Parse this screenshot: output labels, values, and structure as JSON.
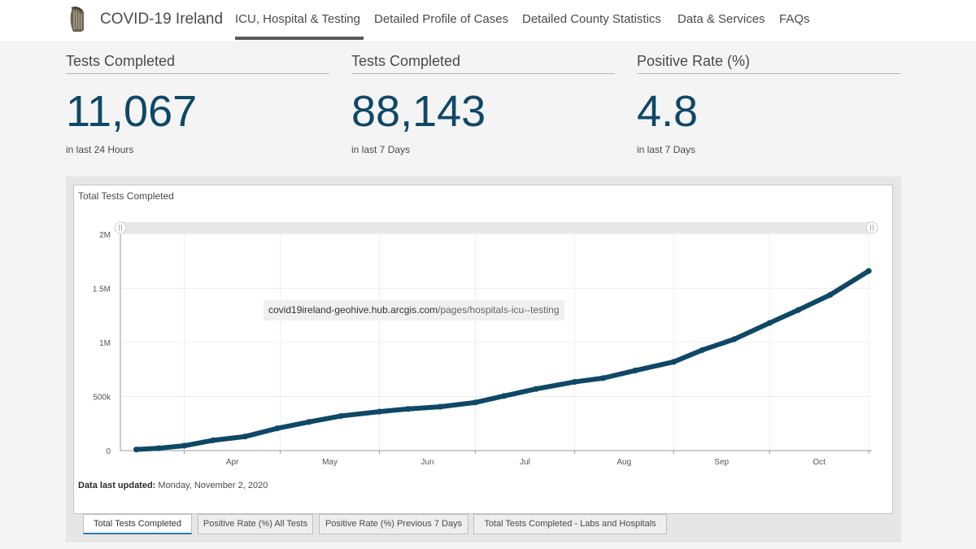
{
  "header": {
    "title": "COVID-19 Ireland",
    "nav": [
      {
        "label": "ICU, Hospital & Testing"
      },
      {
        "label": "Detailed Profile of Cases"
      },
      {
        "label": "Detailed County Statistics"
      },
      {
        "label": "Data & Services"
      },
      {
        "label": "FAQs"
      }
    ],
    "active_tab": "ICU, Hospital & Testing"
  },
  "kpis": [
    {
      "title": "Tests Completed",
      "value": "11,067",
      "subtitle": "in last 24 Hours"
    },
    {
      "title": "Tests Completed",
      "value": "88,143",
      "subtitle": "in last 7 Days"
    },
    {
      "title": "Positive Rate (%)",
      "value": "4.8",
      "subtitle": "in last 7 Days"
    }
  ],
  "chart_panel": {
    "title": "Total Tests Completed",
    "updated_label": "Data last updated:",
    "updated_value": "Monday, November 2, 2020",
    "tooltip_host": "covid19ireland-geohive.hub.arcgis.com",
    "tooltip_path": "/pages/hospitals-icu--testing",
    "tabs": [
      {
        "label": "Total Tests Completed",
        "active": true
      },
      {
        "label": "Positive Rate (%) All Tests",
        "active": false
      },
      {
        "label": "Positive Rate (%) Previous 7 Days",
        "active": false
      },
      {
        "label": "Total Tests Completed - Labs and Hospitals",
        "active": false
      }
    ]
  },
  "colors": {
    "accent": "#0e4866",
    "series": "#0e4866",
    "tab_active": "#2a79b8"
  },
  "chart_data": {
    "type": "line",
    "title": "Total Tests Completed",
    "xlabel": "",
    "ylabel": "",
    "ylim": [
      0,
      2000000
    ],
    "yticks": [
      0,
      500000,
      1000000,
      1500000,
      2000000
    ],
    "ytick_labels": [
      "0",
      "500k",
      "1M",
      "1.5M",
      "2M"
    ],
    "xticks": [
      "Apr",
      "May",
      "Jun",
      "Jul",
      "Aug",
      "Sep",
      "Oct"
    ],
    "grid": true,
    "series": [
      {
        "name": "",
        "x": [
          "2020-03-17",
          "2020-03-24",
          "2020-04-01",
          "2020-04-10",
          "2020-04-20",
          "2020-04-30",
          "2020-05-10",
          "2020-05-20",
          "2020-06-01",
          "2020-06-10",
          "2020-06-20",
          "2020-07-01",
          "2020-07-10",
          "2020-07-20",
          "2020-08-01",
          "2020-08-10",
          "2020-08-20",
          "2020-09-01",
          "2020-09-10",
          "2020-09-20",
          "2020-10-01",
          "2020-10-10",
          "2020-10-20",
          "2020-11-01"
        ],
        "y": [
          10000,
          22000,
          45000,
          95000,
          130000,
          205000,
          265000,
          320000,
          360000,
          385000,
          405000,
          445000,
          505000,
          570000,
          635000,
          670000,
          740000,
          820000,
          930000,
          1030000,
          1180000,
          1300000,
          1440000,
          1660000
        ]
      }
    ]
  }
}
